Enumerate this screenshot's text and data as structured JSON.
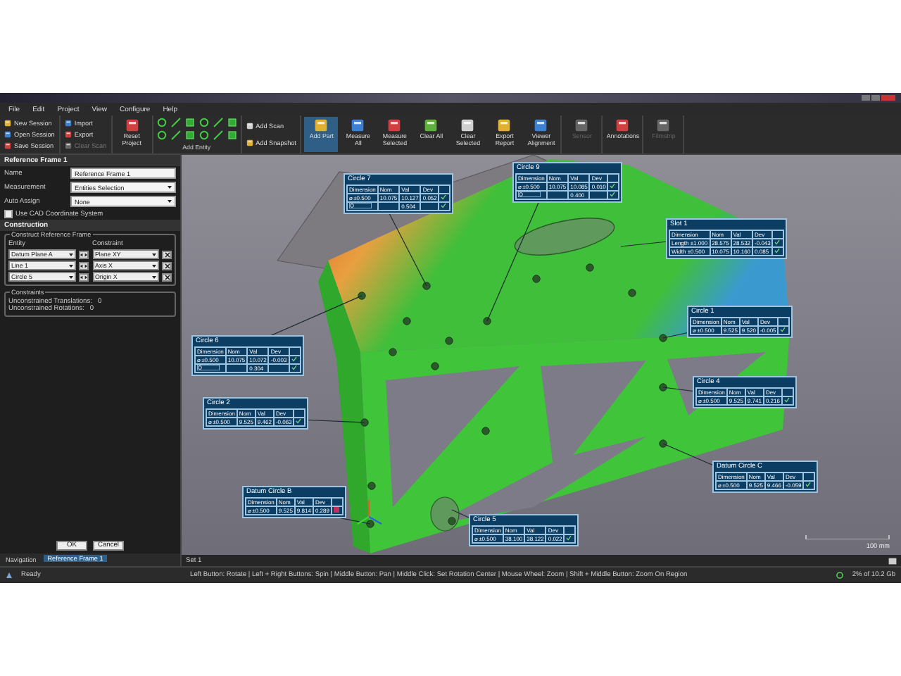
{
  "menu": [
    "File",
    "Edit",
    "Project",
    "View",
    "Configure",
    "Help"
  ],
  "ribbon": [
    {
      "kind": "small",
      "items": [
        {
          "label": "New Session",
          "disabled": false,
          "on": false
        },
        {
          "label": "Open Session",
          "disabled": false,
          "on": false
        },
        {
          "label": "Save Session",
          "disabled": false,
          "on": false
        }
      ]
    },
    {
      "kind": "small",
      "items": [
        {
          "label": "Import",
          "disabled": false,
          "on": false
        },
        {
          "label": "Export",
          "disabled": false,
          "on": false
        },
        {
          "label": "Clear Scan",
          "disabled": true,
          "on": false
        }
      ]
    },
    {
      "kind": "large",
      "items": [
        {
          "label": "Reset Project",
          "disabled": false,
          "on": false
        }
      ]
    },
    {
      "kind": "entity",
      "label": "Add Entity"
    },
    {
      "kind": "small",
      "items": [
        {
          "label": "Add Scan",
          "disabled": false,
          "on": false
        },
        {
          "label": "Add Snapshot",
          "disabled": false,
          "on": false
        }
      ]
    },
    {
      "kind": "large",
      "items": [
        {
          "label": "Add Part",
          "disabled": false,
          "on": true
        },
        {
          "label": "Measure All",
          "disabled": false,
          "on": false
        },
        {
          "label": "Measure Selected",
          "disabled": false,
          "on": false
        },
        {
          "label": "Clear All",
          "disabled": false,
          "on": false
        },
        {
          "label": "Clear Selected",
          "disabled": false,
          "on": false
        },
        {
          "label": "Export Report",
          "disabled": false,
          "on": false
        },
        {
          "label": "Viewer Alignment",
          "disabled": false,
          "on": false
        }
      ]
    },
    {
      "kind": "large",
      "items": [
        {
          "label": "Sensor",
          "disabled": true,
          "on": false
        }
      ]
    },
    {
      "kind": "large",
      "items": [
        {
          "label": "Annotations",
          "disabled": false,
          "on": false
        }
      ]
    },
    {
      "kind": "large",
      "items": [
        {
          "label": "Filmstrip",
          "disabled": true,
          "on": false
        }
      ]
    }
  ],
  "panel": {
    "title": "Reference Frame 1",
    "fields": [
      {
        "label": "Name",
        "kind": "text",
        "value": "Reference Frame 1"
      },
      {
        "label": "Measurement",
        "kind": "select",
        "value": "Entities Selection"
      },
      {
        "label": "Auto Assign",
        "kind": "select",
        "value": "None"
      }
    ],
    "cad_checkbox": {
      "label": "Use CAD Coordinate System",
      "checked": false
    },
    "section": "Construction",
    "construct": {
      "title": "Construct Reference Frame",
      "columns": [
        "Entity",
        "Constraint"
      ],
      "rows": [
        {
          "entity": "Datum Plane A",
          "constraint": "Plane XY"
        },
        {
          "entity": "Line 1",
          "constraint": "Axis X"
        },
        {
          "entity": "Circle 5",
          "constraint": "Origin X"
        }
      ]
    },
    "constraints": {
      "title": "Constraints",
      "rows": [
        {
          "label": "Unconstrained Translations:",
          "value": "0"
        },
        {
          "label": "Unconstrained Rotations:",
          "value": "0"
        }
      ]
    },
    "buttons": [
      "OK",
      "Cancel"
    ],
    "tabs": [
      {
        "label": "Navigation",
        "selected": false
      },
      {
        "label": "Reference Frame 1",
        "selected": true
      }
    ]
  },
  "callouts": [
    {
      "title": "Circle 7",
      "columns": [
        "Dimension",
        "Nom",
        "Val",
        "Dev"
      ],
      "rows": [
        {
          "kind": "diameter",
          "cells": [
            "⌀ ±0.500",
            "10.075",
            "10.127",
            "0.052"
          ],
          "pass": true
        },
        {
          "kind": "position",
          "cells": [
            "",
            "",
            "0.504",
            ""
          ],
          "pass": true
        }
      ]
    },
    {
      "title": "Circle 9",
      "columns": [
        "Dimension",
        "Nom",
        "Val",
        "Dev"
      ],
      "rows": [
        {
          "kind": "diameter",
          "cells": [
            "⌀ ±0.500",
            "10.075",
            "10.085",
            "0.010"
          ],
          "pass": true
        },
        {
          "kind": "position",
          "cells": [
            "",
            "",
            "0.400",
            ""
          ],
          "pass": true
        }
      ]
    },
    {
      "title": "Slot 1",
      "columns": [
        "Dimension",
        "Nom",
        "Val",
        "Dev"
      ],
      "rows": [
        {
          "kind": "diameter",
          "cells": [
            "Length ±1.000",
            "28.575",
            "28.532",
            "-0.043"
          ],
          "pass": true
        },
        {
          "kind": "diameter",
          "cells": [
            "Width ±0.500",
            "10.075",
            "10.160",
            "0.085"
          ],
          "pass": true
        }
      ]
    },
    {
      "title": "Circle 6",
      "columns": [
        "Dimension",
        "Nom",
        "Val",
        "Dev"
      ],
      "rows": [
        {
          "kind": "diameter",
          "cells": [
            "⌀ ±0.500",
            "10.075",
            "10.072",
            "-0.003"
          ],
          "pass": true
        },
        {
          "kind": "position",
          "cells": [
            "",
            "",
            "0.304",
            ""
          ],
          "pass": true
        }
      ]
    },
    {
      "title": "Circle 1",
      "columns": [
        "Dimension",
        "Nom",
        "Val",
        "Dev"
      ],
      "rows": [
        {
          "kind": "diameter",
          "cells": [
            "⌀ ±0.500",
            "9.525",
            "9.520",
            "-0.005"
          ],
          "pass": true
        }
      ]
    },
    {
      "title": "Circle 4",
      "columns": [
        "Dimension",
        "Nom",
        "Val",
        "Dev"
      ],
      "rows": [
        {
          "kind": "diameter",
          "cells": [
            "⌀ ±0.500",
            "9.525",
            "9.741",
            "0.216"
          ],
          "pass": true
        }
      ]
    },
    {
      "title": "Circle 2",
      "columns": [
        "Dimension",
        "Nom",
        "Val",
        "Dev"
      ],
      "rows": [
        {
          "kind": "diameter",
          "cells": [
            "⌀ ±0.500",
            "9.525",
            "9.462",
            "-0.063"
          ],
          "pass": true
        }
      ]
    },
    {
      "title": "Datum Circle C",
      "columns": [
        "Dimension",
        "Nom",
        "Val",
        "Dev"
      ],
      "rows": [
        {
          "kind": "diameter",
          "cells": [
            "⌀ ±0.500",
            "9.525",
            "9.466",
            "-0.059"
          ],
          "pass": true
        }
      ]
    },
    {
      "title": "Datum Circle B",
      "columns": [
        "Dimension",
        "Nom",
        "Val",
        "Dev"
      ],
      "rows": [
        {
          "kind": "diameter",
          "cells": [
            "⌀ ±0.500",
            "9.525",
            "9.814",
            "0.289"
          ],
          "pass": false
        }
      ]
    },
    {
      "title": "Circle 5",
      "columns": [
        "Dimension",
        "Nom",
        "Val",
        "Dev"
      ],
      "rows": [
        {
          "kind": "diameter",
          "cells": [
            "⌀ ±0.500",
            "38.100",
            "38.122",
            "0.022"
          ],
          "pass": true
        }
      ]
    }
  ],
  "scale": "100 mm",
  "set_tab": "Set 1",
  "status_bar": {
    "state": "Ready",
    "hint": "Left Button: Rotate | Left + Right Buttons: Spin | Middle Button: Pan | Middle Click: Set Rotation Center | Mouse Wheel: Zoom | Shift + Middle Button: Zoom On Region",
    "memory": "2% of 10.2 Gb"
  }
}
